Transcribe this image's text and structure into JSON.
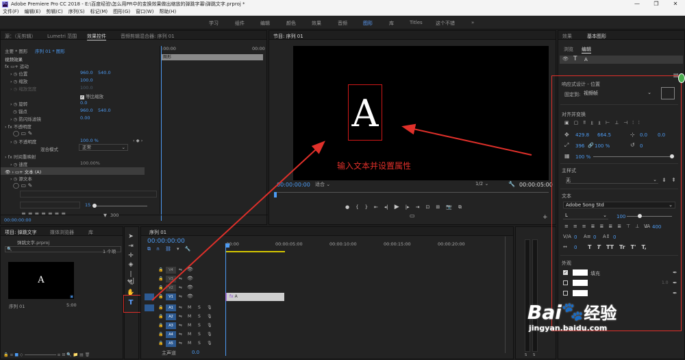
{
  "window": {
    "app_icon": "Pr",
    "title": "Adobe Premiere Pro CC 2018 - E:\\百度经验\\怎么用PR中的变换效果做出缩放的弹跳字幕\\弹跳文字.prproj *",
    "minimize": "—",
    "maximize": "❐",
    "close": "✕"
  },
  "menu": [
    "文件(F)",
    "编辑(E)",
    "剪辑(C)",
    "序列(S)",
    "标记(M)",
    "图形(G)",
    "窗口(W)",
    "帮助(H)"
  ],
  "workspaces": [
    {
      "label": "学习",
      "active": false
    },
    {
      "label": "组件",
      "active": false
    },
    {
      "label": "编辑",
      "active": false
    },
    {
      "label": "颜色",
      "active": false
    },
    {
      "label": "效果",
      "active": false
    },
    {
      "label": "音频",
      "active": false
    },
    {
      "label": "图形",
      "active": true
    },
    {
      "label": "库",
      "active": false
    },
    {
      "label": "Titles",
      "active": false
    },
    {
      "label": "这个不错",
      "active": false
    }
  ],
  "workspace_more": "»",
  "effect_controls": {
    "tabs": {
      "source": "源：（无剪辑）",
      "lumetri": "Lumetri 范围",
      "effects": "效果控件",
      "mixer": "音频剪辑混合器: 序列 01"
    },
    "master": "主要 * 图形",
    "clip": "序列 01 * 图形",
    "clip_label": "图形",
    "ruler_start": ":00:00",
    "ruler_end": "00:00",
    "video_effects": "视频效果",
    "motion": "运动",
    "position": {
      "label": "位置",
      "x": "960.0",
      "y": "540.0"
    },
    "scale": {
      "label": "缩放",
      "value": "100.0"
    },
    "scale_width": {
      "label": "缩放宽度",
      "value": "100.0"
    },
    "uniform_scale": "等比缩放",
    "rotation": {
      "label": "旋转",
      "value": "0.0"
    },
    "anchor": {
      "label": "锚点",
      "x": "960.0",
      "y": "540.0"
    },
    "anti_flicker": {
      "label": "防闪烁滤镜",
      "value": "0.00"
    },
    "opacity_group": "不透明度",
    "opacity": {
      "label": "不透明度",
      "value": "100.0 %"
    },
    "blend": {
      "label": "混合模式",
      "value": "正常"
    },
    "time_remap": "时间重映射",
    "speed": {
      "label": "速度",
      "value": "100.00%"
    },
    "text_layer": "文本 (A)",
    "source_text": "源文本",
    "font_size": "15",
    "timecode": "00:00:00:00",
    "frame_count": "300"
  },
  "program": {
    "title": "节目: 序列 01",
    "letter": "A",
    "annotation": "输入文本并设置属性",
    "timecode": "00:00:00:00",
    "fit": "适合",
    "resolution": "1/2",
    "duration": "00:00:05:00"
  },
  "project": {
    "tabs": {
      "project": "项目: 弹跳文字",
      "browser": "媒体浏览器",
      "library": "库"
    },
    "file": "弹跳文字.prproj",
    "count": "1 个项",
    "thumb_letter": "A",
    "item_name": "序列 01",
    "item_duration": "5:00"
  },
  "timeline": {
    "title": "序列 01",
    "timecode": "00:00:00:00",
    "ruler": [
      ":00:00",
      "00:00:05:00",
      "00:00:10:00",
      "00:00:15:00",
      "00:00:20:00"
    ],
    "video_tracks": [
      "V4",
      "V3",
      "V2",
      "V1"
    ],
    "audio_tracks": [
      "A1",
      "A2",
      "A3",
      "A4",
      "A5"
    ],
    "master": "主声道",
    "master_value": "0.0",
    "clip_label": "A",
    "mute": "M",
    "solo": "S"
  },
  "essential_graphics": {
    "tabs": {
      "effects": "效果",
      "eg": "基本图形"
    },
    "subtabs": {
      "browse": "浏览",
      "edit": "编辑"
    },
    "layer": "A",
    "responsive": "响应式设计 - 位置",
    "pin_label": "固定到:",
    "pin_value": "视频帧",
    "align": "对齐并变换",
    "pos_x": "429.8",
    "pos_y": "664.5",
    "anchor_x": "0.0",
    "anchor_y": "0.0",
    "scale": "396",
    "scale_pct": "100 %",
    "rotation": "0",
    "opacity": "100 %",
    "master_styles": "主样式",
    "style_value": "无",
    "text_section": "文本",
    "font": "Adobe Song Std",
    "font_style": "L",
    "font_size": "100",
    "tracking": "400",
    "metric_values": [
      "0",
      "0",
      "0",
      "0"
    ],
    "type_buttons": [
      "T",
      "T",
      "TT",
      "Tr",
      "T'",
      "T,"
    ],
    "appearance": "外观",
    "fill": "填充",
    "stroke_value": "1.0"
  },
  "watermark": {
    "brand": "Bai",
    "cn": "经验",
    "url": "jingyan.baidu.com"
  },
  "colors": {
    "accent": "#4d9cf5",
    "highlight": "#e0302a",
    "clip": "#cfcfcf"
  }
}
